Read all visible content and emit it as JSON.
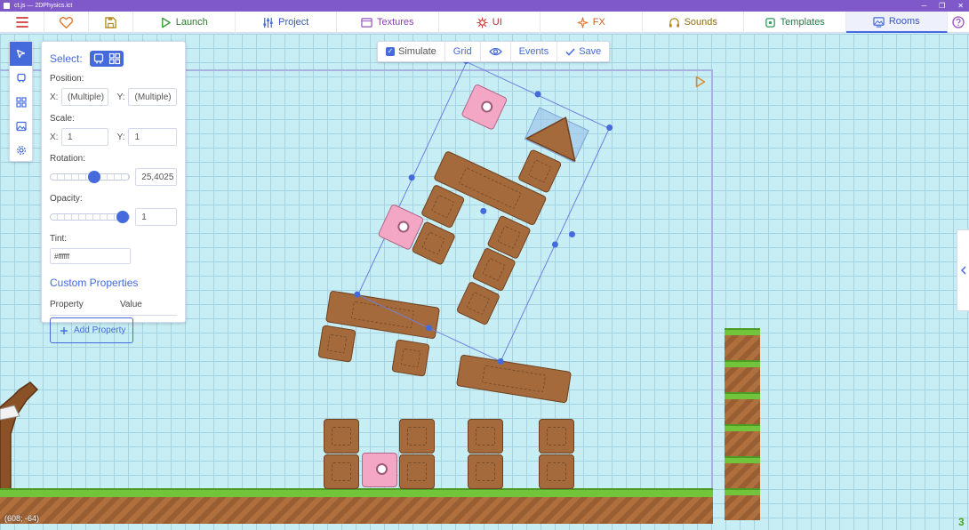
{
  "window": {
    "title": "ct.js — 2DPhysics.ict"
  },
  "tabs": [
    {
      "label": "Launch",
      "icon": "play-icon",
      "color": "#3a9c3a"
    },
    {
      "label": "Project",
      "icon": "sliders-icon",
      "color": "#446adb"
    },
    {
      "label": "Textures",
      "icon": "texture-icon",
      "color": "#9b4fc4"
    },
    {
      "label": "UI",
      "icon": "ui-icon",
      "color": "#d23c3c"
    },
    {
      "label": "FX",
      "icon": "sparkle-icon",
      "color": "#e0752b"
    },
    {
      "label": "Sounds",
      "icon": "headphones-icon",
      "color": "#b58a1a"
    },
    {
      "label": "Templates",
      "icon": "template-icon",
      "color": "#2e9a5c"
    },
    {
      "label": "Rooms",
      "icon": "room-icon",
      "color": "#446adb"
    }
  ],
  "toolbar": {
    "simulate": "Simulate",
    "simulate_checked": true,
    "grid": "Grid",
    "events": "Events",
    "save": "Save"
  },
  "properties": {
    "select_label": "Select:",
    "position_label": "Position:",
    "position_x": "(Multiple)",
    "position_y": "(Multiple)",
    "scale_label": "Scale:",
    "scale_x": "1",
    "scale_y": "1",
    "rotation_label": "Rotation:",
    "rotation_value": "25,4025",
    "rotation_level": 0.56,
    "opacity_label": "Opacity:",
    "opacity_value": "1",
    "opacity_level": 1.0,
    "tint_label": "Tint:",
    "tint_value": "#ffffff",
    "custom_title": "Custom Properties",
    "col_property": "Property",
    "col_value": "Value",
    "add_button": "Add Property",
    "x_label": "X:",
    "y_label": "Y:"
  },
  "status": {
    "coords": "(608; -64)",
    "counter": "3"
  },
  "colors": {
    "accent": "#446adb",
    "titlebar": "#7f59c9"
  }
}
